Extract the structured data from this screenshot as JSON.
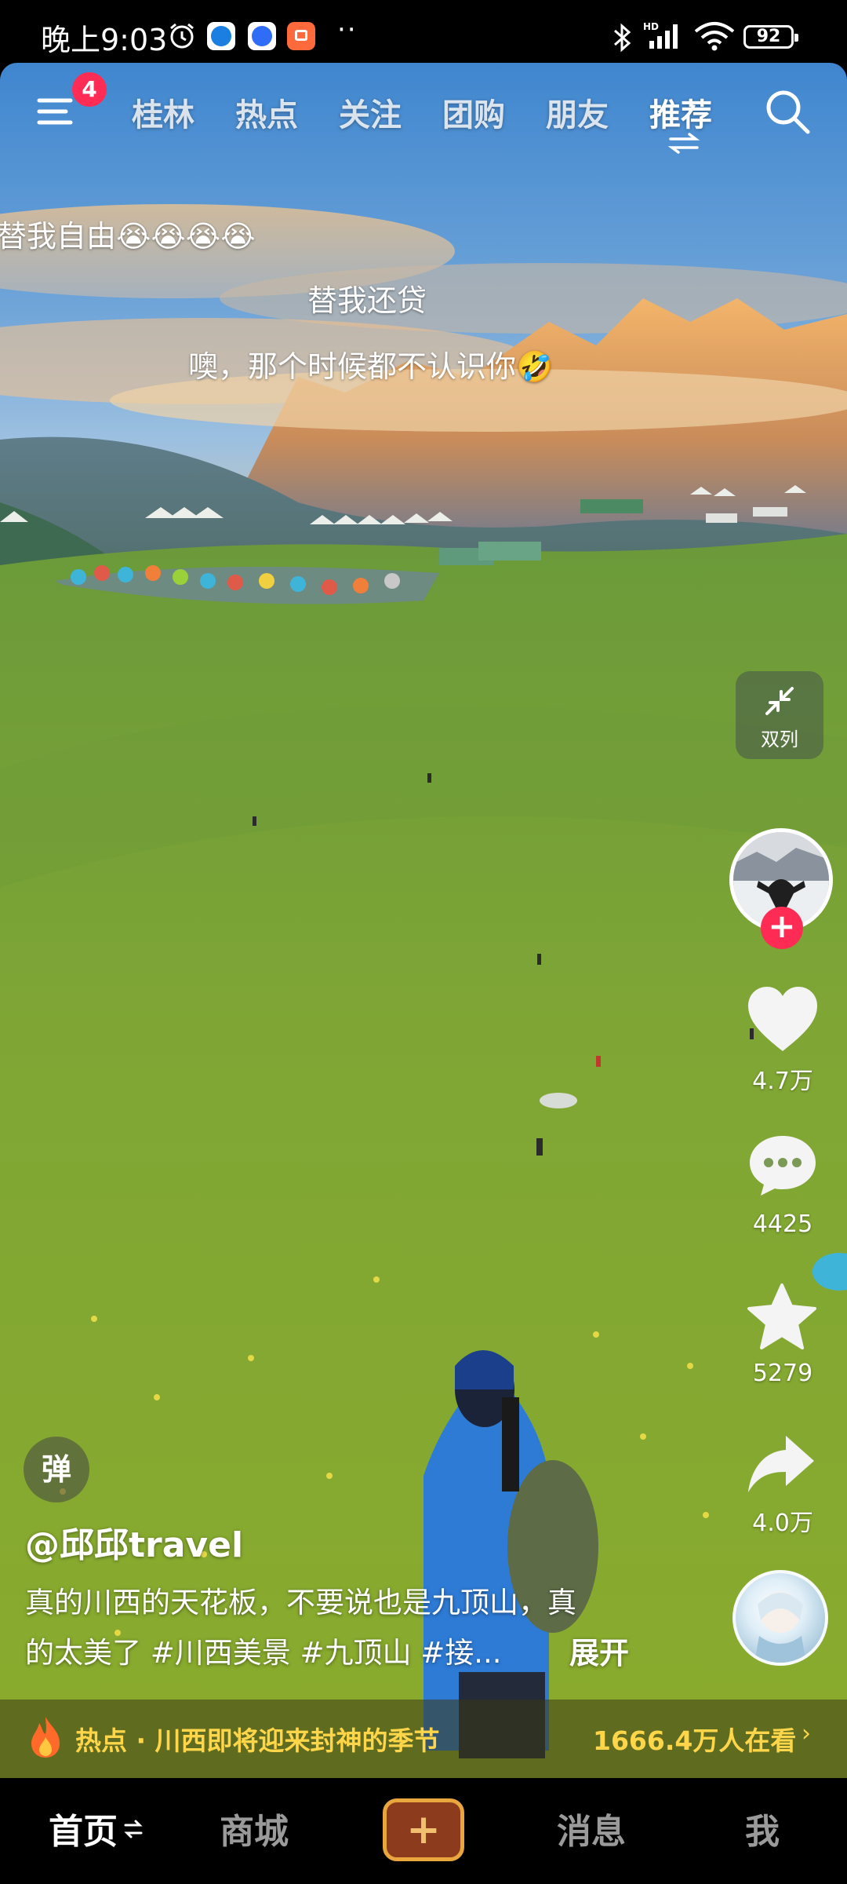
{
  "status_bar": {
    "time": "晚上9:03",
    "battery": "92",
    "network_label": "HD",
    "app_icons": [
      "alarm-icon",
      "app-blue-icon",
      "app-messenger-icon",
      "app-orange-icon"
    ],
    "dots": "··"
  },
  "top_nav": {
    "menu_badge": "4",
    "tabs": [
      {
        "label": "桂林",
        "active": false
      },
      {
        "label": "热点",
        "active": false
      },
      {
        "label": "关注",
        "active": false
      },
      {
        "label": "团购",
        "active": false
      },
      {
        "label": "朋友",
        "active": false
      },
      {
        "label": "推荐",
        "active": true
      }
    ]
  },
  "danmaku": [
    {
      "text": "替我自由😭😭😭😭"
    },
    {
      "text": "替我还贷"
    },
    {
      "text": "噢，那个时候都不认识你🤣"
    }
  ],
  "right_rail": {
    "double_column_label": "双列",
    "follow_symbol": "+",
    "like_count": "4.7万",
    "comment_count": "4425",
    "favorite_count": "5279",
    "share_count": "4.0万"
  },
  "post": {
    "danmu_toggle_label": "弹",
    "author": "@邱邱travel",
    "description_lines": [
      "真的川西的天花板，不要说也是九顶山，真",
      "的太美了 #川西美景 #九顶山 #接..."
    ],
    "expand_label": "展开"
  },
  "hot_bar": {
    "text": "热点 · 川西即将迎来封神的季节",
    "viewers": "1666.4万人在看",
    "chevron": "›"
  },
  "bottom_nav": {
    "items": [
      {
        "label": "首页",
        "active": true
      },
      {
        "label": "商城",
        "active": false
      },
      {
        "label": "消息",
        "active": false
      },
      {
        "label": "我",
        "active": false
      }
    ],
    "create_symbol": "+"
  },
  "colors": {
    "accent_red": "#fe2c55",
    "hot_yellow": "#ffd54a",
    "grass_green": "#7ea534",
    "sky_blue": "#4a8fd4"
  }
}
